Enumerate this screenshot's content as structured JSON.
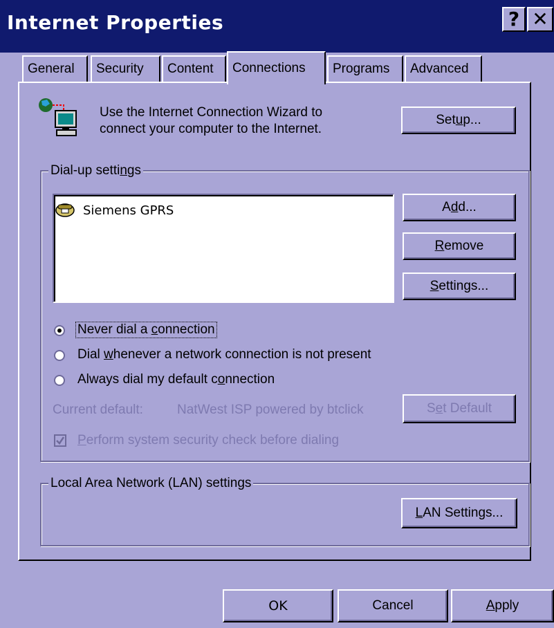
{
  "window": {
    "title": "Internet Properties",
    "help_glyph": "?",
    "close_glyph": "✕"
  },
  "tabs": [
    {
      "label": "General"
    },
    {
      "label": "Security"
    },
    {
      "label": "Content"
    },
    {
      "label": "Connections",
      "active": true
    },
    {
      "label": "Programs"
    },
    {
      "label": "Advanced"
    }
  ],
  "wizard": {
    "line1": "Use the Internet Connection Wizard to",
    "line2": "connect your computer to the Internet.",
    "setup_button": {
      "pre": "Set",
      "accel": "u",
      "post": "p..."
    }
  },
  "dialup": {
    "group_label": {
      "pre": "Dial-up setti",
      "accel": "n",
      "post": "gs"
    },
    "connections": [
      "Siemens GPRS"
    ],
    "add_button": {
      "pre": "A",
      "accel": "d",
      "post": "d..."
    },
    "remove_button": {
      "pre": "",
      "accel": "R",
      "post": "emove"
    },
    "settings_button": {
      "pre": "",
      "accel": "S",
      "post": "ettings..."
    },
    "options": [
      {
        "pre": "Never dial a ",
        "accel": "c",
        "post": "onnection",
        "selected": true
      },
      {
        "pre": "Dial ",
        "accel": "w",
        "post": "henever a network connection is not present",
        "selected": false
      },
      {
        "pre": "Always dial my default c",
        "accel": "o",
        "post": "nnection",
        "selected": false
      }
    ],
    "current_default_label": "Current default:",
    "current_default_value": "NatWest ISP powered by btclick",
    "set_default_button": {
      "pre": "S",
      "accel": "e",
      "post": "t Default"
    },
    "security_check": {
      "pre": "",
      "accel": "P",
      "post": "erform system security check before dialing",
      "checked": true
    }
  },
  "lan": {
    "group_label": "Local Area Network (LAN) settings",
    "lan_settings_button": {
      "pre": "",
      "accel": "L",
      "post": "AN Settings..."
    }
  },
  "footer": {
    "ok": "OK",
    "cancel": "Cancel",
    "apply": {
      "pre": "",
      "accel": "A",
      "post": "pply"
    }
  },
  "colors": {
    "face": "#a9a5d6",
    "titlebar": "#101a6e",
    "disabled_text": "#7e7ab0"
  }
}
